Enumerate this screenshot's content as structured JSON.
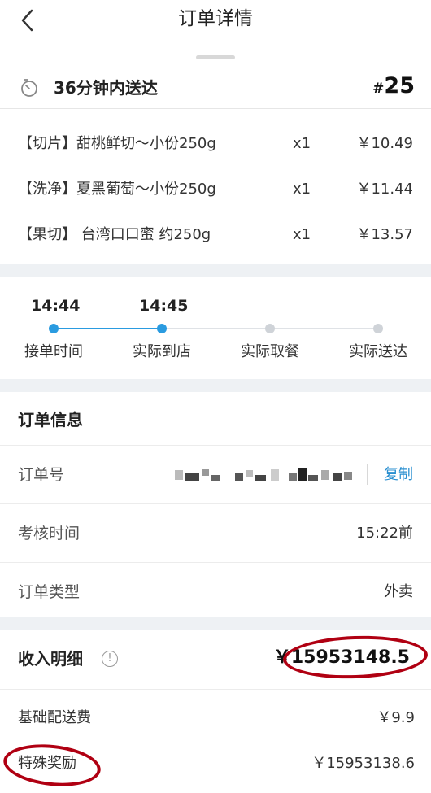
{
  "header": {
    "title": "订单详情"
  },
  "delivery": {
    "text": "36分钟内送达",
    "order_hash": "#",
    "order_number": "25"
  },
  "items": [
    {
      "name": "【切片】甜桃鲜切～小份250g",
      "qty": "x1",
      "price": "￥10.49"
    },
    {
      "name": "【洗净】夏黑葡萄～小份250g",
      "qty": "x1",
      "price": "￥11.44"
    },
    {
      "name": "【果切】 台湾口口蜜 约250g",
      "qty": "x1",
      "price": "￥13.57"
    }
  ],
  "timeline": {
    "steps": [
      {
        "time": "14:44",
        "label": "接单时间",
        "done": true
      },
      {
        "time": "14:45",
        "label": "实际到店",
        "done": true
      },
      {
        "time": "",
        "label": "实际取餐",
        "done": false
      },
      {
        "time": "",
        "label": "实际送达",
        "done": false
      }
    ],
    "active_color": "#2a9be0",
    "inactive_color": "#cfd3d8"
  },
  "order_info": {
    "title": "订单信息",
    "order_no_label": "订单号",
    "copy_label": "复制",
    "check_time_label": "考核时间",
    "check_time_value": "15:22前",
    "order_type_label": "订单类型",
    "order_type_value": "外卖"
  },
  "income": {
    "title": "收入明细",
    "info_glyph": "!",
    "total": "￥15953148.5",
    "rows": [
      {
        "label": "基础配送费",
        "value": "￥9.9"
      },
      {
        "label": "特殊奖励",
        "value": "￥15953138.6"
      }
    ]
  },
  "colors": {
    "accent": "#2a8fd0",
    "annotation": "#b00012",
    "separator": "#eef1f4"
  }
}
